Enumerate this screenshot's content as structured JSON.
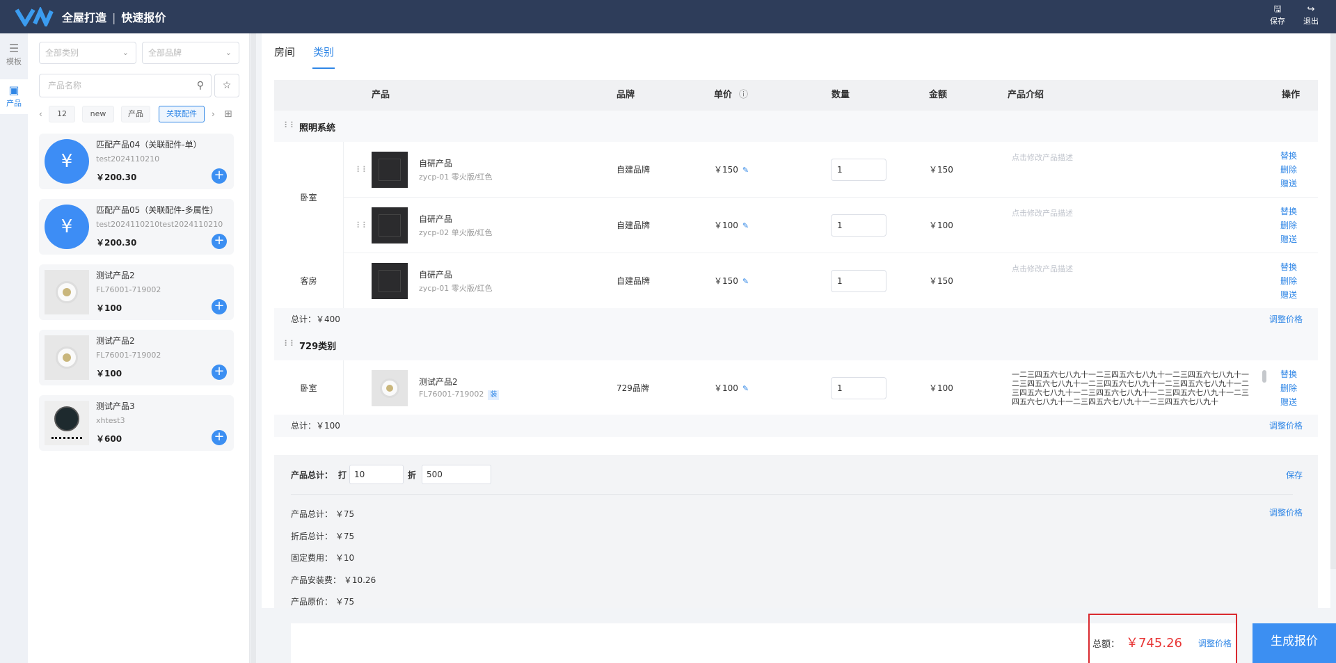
{
  "header": {
    "brand": "全屋打造",
    "separator": "|",
    "subtitle": "快速报价",
    "save_label": "保存",
    "exit_label": "退出"
  },
  "rail": {
    "templates": "模板",
    "products": "产品"
  },
  "filters": {
    "category_placeholder": "全部类别",
    "brand_placeholder": "全部品牌",
    "search_placeholder": "产品名称",
    "tags": [
      "12",
      "new",
      "产品",
      "关联配件"
    ],
    "active_tag": "关联配件"
  },
  "product_list": [
    {
      "name": "匹配产品04（关联配件-单）",
      "code": "test2024110210",
      "price": "￥200.30",
      "icon": "yuan-icon"
    },
    {
      "name": "匹配产品05（关联配件-多属性）",
      "code": "test2024110210test2024110210",
      "price": "￥200.30",
      "icon": "yuan-icon"
    },
    {
      "name": "测试产品2",
      "code": "FL76001-719002",
      "price": "￥100",
      "icon": "downlight-photo"
    },
    {
      "name": "测试产品2",
      "code": "FL76001-719002",
      "price": "￥100",
      "icon": "downlight-photo"
    },
    {
      "name": "测试产品3",
      "code": "xhtest3",
      "price": "￥600",
      "icon": "panel-photo"
    }
  ],
  "tabs": {
    "room": "房间",
    "category": "类别",
    "active": "类别"
  },
  "table": {
    "headers": {
      "product": "产品",
      "brand": "品牌",
      "unit_price": "单价",
      "quantity": "数量",
      "amount": "金额",
      "intro": "产品介绍",
      "action": "操作"
    },
    "actions": {
      "replace": "替换",
      "delete": "删除",
      "gift": "赠送"
    },
    "groups": [
      {
        "name": "照明系统",
        "subtotal": "总计：￥400",
        "adjust": "调整价格",
        "rows": [
          {
            "room": "卧室",
            "name": "自研产品",
            "code": "zycp-01 零火版/红色",
            "brand": "自建品牌",
            "price": "￥150",
            "qty": "1",
            "amount": "￥150",
            "desc": "点击修改产品描述"
          },
          {
            "room": "",
            "name": "自研产品",
            "code": "zycp-02 单火版/红色",
            "brand": "自建品牌",
            "price": "￥100",
            "qty": "1",
            "amount": "￥100",
            "desc": "点击修改产品描述"
          },
          {
            "room": "客房",
            "name": "自研产品",
            "code": "zycp-01 零火版/红色",
            "brand": "自建品牌",
            "price": "￥150",
            "qty": "1",
            "amount": "￥150",
            "desc": "点击修改产品描述"
          }
        ]
      },
      {
        "name": "729类别",
        "subtotal": "总计：￥100",
        "adjust": "调整价格",
        "rows": [
          {
            "room": "卧室",
            "name": "测试产品2",
            "code": "FL76001-719002",
            "badge": "装",
            "brand": "729品牌",
            "price": "￥100",
            "qty": "1",
            "amount": "￥100",
            "desc": "一二三四五六七八九十一二三四五六七八九十一二三四五六七八九十一二三四五六七八九十一二三四五六七八九十一二三四五六七八九十一二三四五六七八九十一二三四五六七八九十一二三四五六七八九十一二三四五六七八九十一二三四五六七八九十一二三四五六七八九十"
          }
        ]
      }
    ]
  },
  "summary": {
    "label": "产品总计：",
    "discount_label": "打",
    "discount_value": "10",
    "zhe_label": "折",
    "amount_value": "500",
    "save": "保存",
    "adjust": "调整价格",
    "lines": [
      {
        "label": "产品总计：",
        "value": "￥75"
      },
      {
        "label": "折后总计：",
        "value": "￥75"
      },
      {
        "label": "固定费用：",
        "value": "￥10"
      },
      {
        "label": "产品安装费：",
        "value": "￥10.26"
      },
      {
        "label": "产品原价：",
        "value": "￥75"
      }
    ]
  },
  "footer": {
    "total_label": "总额：",
    "total_value": "￥745.26",
    "adjust": "调整价格",
    "generate": "生成报价"
  }
}
